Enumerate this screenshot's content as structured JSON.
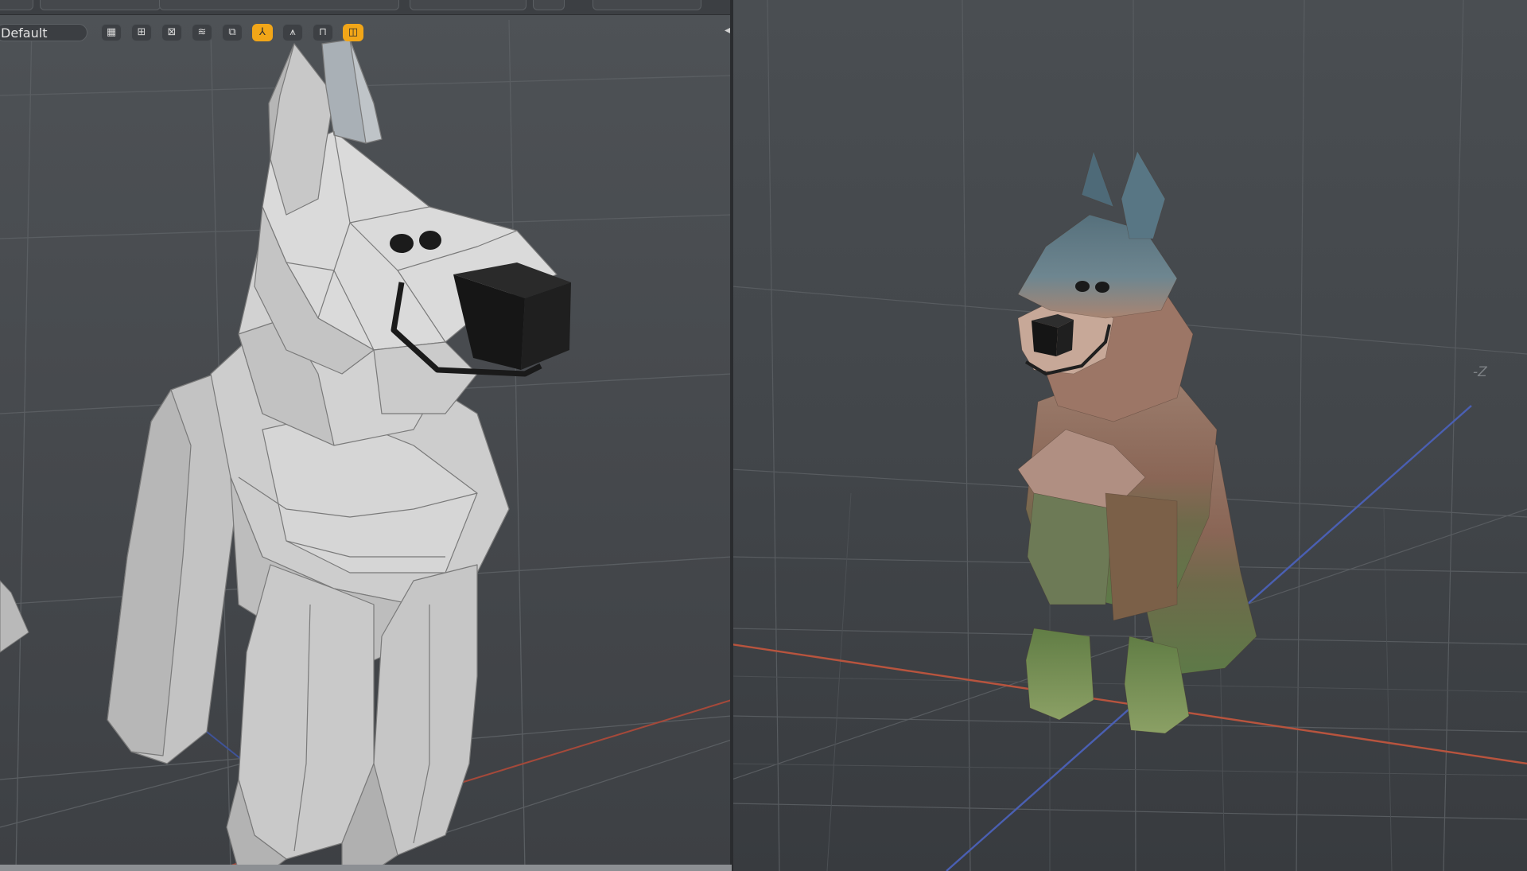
{
  "viewport_left": {
    "preset": "Default",
    "toolbar_icons": [
      {
        "name": "checker-icon",
        "glyph": "▦",
        "active": false
      },
      {
        "name": "grid-pattern-icon",
        "glyph": "⊞",
        "active": false
      },
      {
        "name": "x-ray-icon",
        "glyph": "⊠",
        "active": false
      },
      {
        "name": "wireframe-icon",
        "glyph": "≋",
        "active": false
      },
      {
        "name": "layer-icon",
        "glyph": "⧉",
        "active": false
      },
      {
        "name": "axis-icon",
        "glyph": "⅄",
        "active": true
      },
      {
        "name": "constraint-icon",
        "glyph": "⩚",
        "active": false
      },
      {
        "name": "mirror-icon",
        "glyph": "⊓",
        "active": false
      },
      {
        "name": "symmetry-icon",
        "glyph": "◫",
        "active": true
      }
    ]
  },
  "viewport_right": {
    "axis_label": "-Z"
  },
  "colors": {
    "active_accent": "#f2a618",
    "x_axis": "#c0503a",
    "z_axis": "#4a62b8",
    "mesh_gray": "#c9c9c9"
  }
}
